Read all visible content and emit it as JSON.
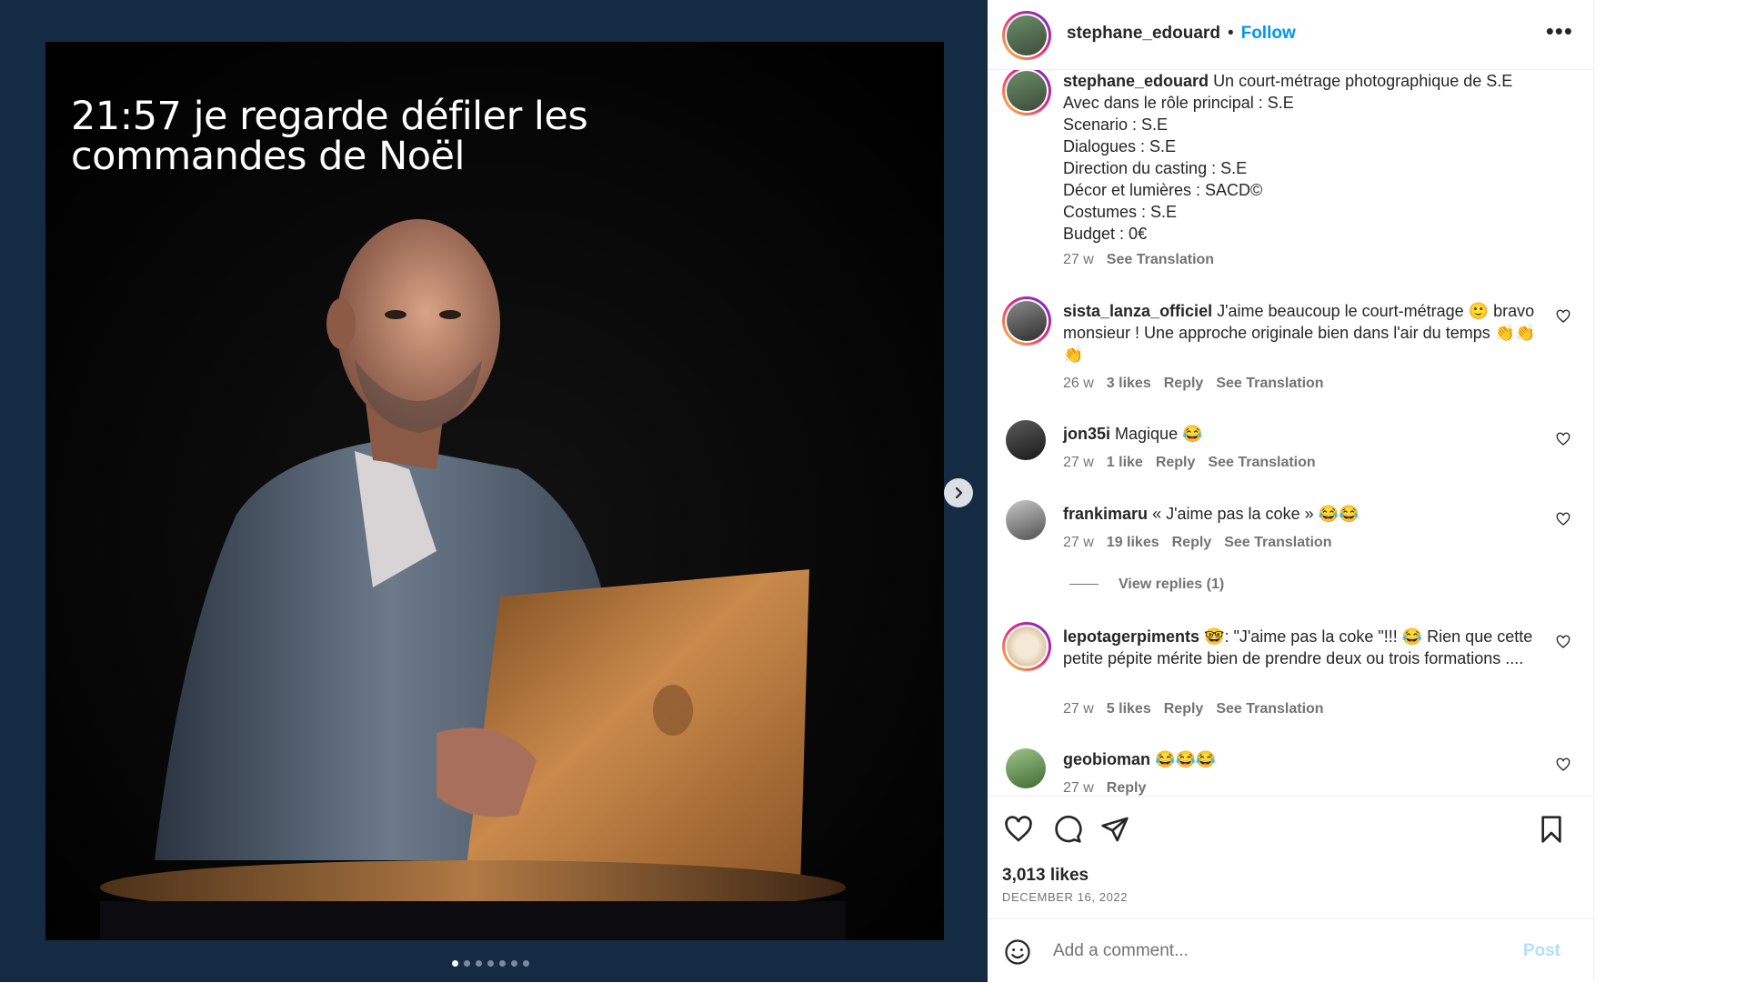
{
  "post": {
    "author": "stephane_edouard",
    "follow_label": "Follow",
    "separator": "•",
    "more_label": "•••",
    "overlay_line1": "21:57 je regarde défiler les",
    "overlay_line2": "commandes de Noël",
    "carousel": {
      "slides": 7,
      "active": 0
    }
  },
  "caption": {
    "user": "stephane_edouard",
    "lines": [
      "Un court-métrage photographique de S.E",
      "Avec dans le rôle principal : S.E",
      "Scenario : S.E",
      "Dialogues : S.E",
      "Direction du casting : S.E",
      "Décor et lumières : SACD©",
      "Costumes : S.E",
      "Budget : 0€"
    ],
    "age": "27 w",
    "translate": "See Translation"
  },
  "comments": [
    {
      "user": "sista_lanza_officiel",
      "text": "J'aime beaucoup le court-métrage 🙂 bravo monsieur ! Une approche originale bien dans l'air du temps 👏👏👏",
      "age": "26 w",
      "likes": "3 likes",
      "reply": "Reply",
      "translate": "See Translation"
    },
    {
      "user": "jon35i",
      "text": "Magique 😂",
      "age": "27 w",
      "likes": "1 like",
      "reply": "Reply",
      "translate": "See Translation"
    },
    {
      "user": "frankimaru",
      "text": "« J'aime pas la coke » 😂😂",
      "age": "27 w",
      "likes": "19 likes",
      "reply": "Reply",
      "translate": "See Translation",
      "view_replies": "View replies (1)"
    },
    {
      "user": "lepotagerpiments",
      "text": "🤓: \"J'aime pas la coke \"!!! 😂 Rien que cette petite pépite mérite bien de prendre deux ou trois formations ....",
      "age": "27 w",
      "likes": "5 likes",
      "reply": "Reply",
      "translate": "See Translation"
    },
    {
      "user": "geobioman",
      "text": "😂😂😂",
      "age": "27 w",
      "reply": "Reply"
    }
  ],
  "footer": {
    "likes": "3,013 likes",
    "date": "DECEMBER 16, 2022",
    "comment_placeholder": "Add a comment...",
    "post_label": "Post"
  },
  "colors": {
    "link": "#0095f6",
    "media_bg": "#152b44",
    "muted": "#737373"
  }
}
